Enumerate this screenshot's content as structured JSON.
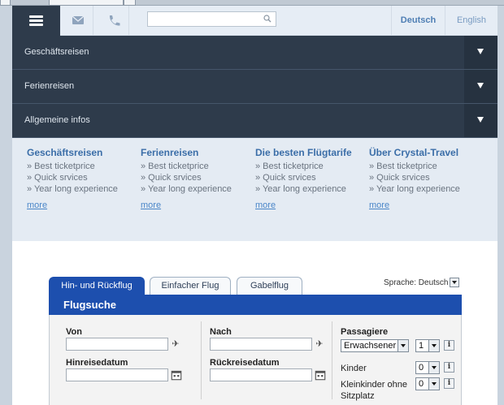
{
  "topbar": {
    "search_placeholder": "",
    "lang_de": "Deutsch",
    "lang_en": "English"
  },
  "accordion": [
    {
      "label": "Geschäftsreisen"
    },
    {
      "label": "Ferienreisen"
    },
    {
      "label": "Allgemeine infos"
    }
  ],
  "info": [
    {
      "title": "Geschäftsreisen",
      "items": [
        "» Best ticketprice",
        "» Quick srvices",
        "» Year long experience"
      ],
      "more": "more"
    },
    {
      "title": "Ferienreisen",
      "items": [
        "» Best ticketprice",
        "» Quick srvices",
        "» Year long experience"
      ],
      "more": "more"
    },
    {
      "title": "Die besten Flügtarife",
      "items": [
        "» Best ticketprice",
        "» Quick srvices",
        "» Year long experience"
      ],
      "more": "more"
    },
    {
      "title": "Über Crystal-Travel",
      "items": [
        "» Best ticketprice",
        "» Quick srvices",
        "» Year long experience"
      ],
      "more": "more"
    }
  ],
  "booking": {
    "tabs": [
      "Hin- und Rückflug",
      "Einfacher Flug",
      "Gabelflug"
    ],
    "language_label": "Sprache: Deutsch",
    "header": "Flugsuche",
    "from_label": "Von",
    "to_label": "Nach",
    "depart_label": "Hinreisedatum",
    "return_label": "Rückreisedatum",
    "passengers_label": "Passagiere",
    "adults_select": "Erwachsener",
    "adults_count": "1",
    "children_label": "Kinder",
    "children_count": "0",
    "infants_label": "Kleinkinder ohne Sitzplatz",
    "infants_count": "0",
    "info_glyph": "i"
  }
}
